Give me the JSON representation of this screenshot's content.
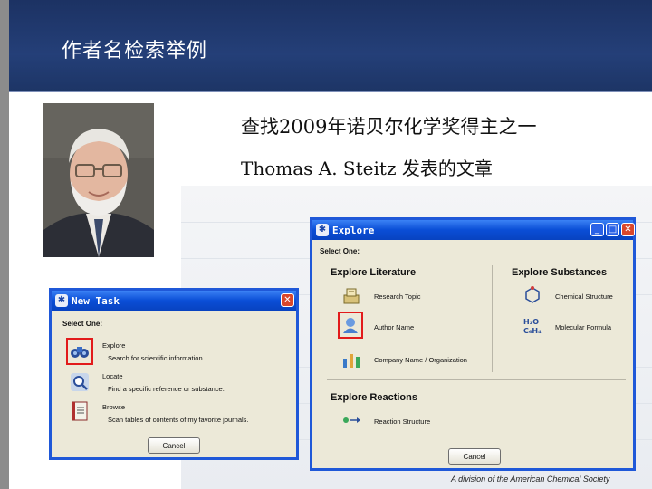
{
  "slide": {
    "title": "作者名检索举例",
    "line1": "查找2009年诺贝尔化学奖得主之一",
    "line2": "Thomas A. Steitz 发表的文章",
    "footer": "A division of the American Chemical Society"
  },
  "explore_window": {
    "title": "Explore",
    "select_one": "Select One:",
    "literature": {
      "title": "Explore Literature",
      "items": [
        {
          "label": "Research Topic",
          "icon": "research-topic-icon"
        },
        {
          "label": "Author Name",
          "icon": "author-name-icon",
          "highlighted": true
        },
        {
          "label": "Company Name / Organization",
          "icon": "company-icon"
        }
      ]
    },
    "substances": {
      "title": "Explore Substances",
      "items": [
        {
          "label": "Chemical Structure",
          "icon": "chemical-structure-icon"
        },
        {
          "label": "Molecular Formula",
          "icon": "molecular-formula-icon"
        }
      ]
    },
    "reactions": {
      "title": "Explore Reactions",
      "items": [
        {
          "label": "Reaction Structure",
          "icon": "reaction-structure-icon"
        }
      ]
    },
    "cancel": "Cancel"
  },
  "new_task_window": {
    "title": "New Task",
    "select_one": "Select One:",
    "items": [
      {
        "label": "Explore",
        "desc": "Search for scientific information.",
        "icon": "binoculars-icon",
        "highlighted": true
      },
      {
        "label": "Locate",
        "desc": "Find a specific reference or substance.",
        "icon": "magnifier-icon"
      },
      {
        "label": "Browse",
        "desc": "Scan tables of contents of my favorite journals.",
        "icon": "journal-icon"
      }
    ],
    "cancel": "Cancel"
  },
  "colors": {
    "header": "#243f78",
    "titlebar": "#0a4ed6",
    "highlight": "#e21b1b",
    "window_bg": "#ece9d8"
  }
}
